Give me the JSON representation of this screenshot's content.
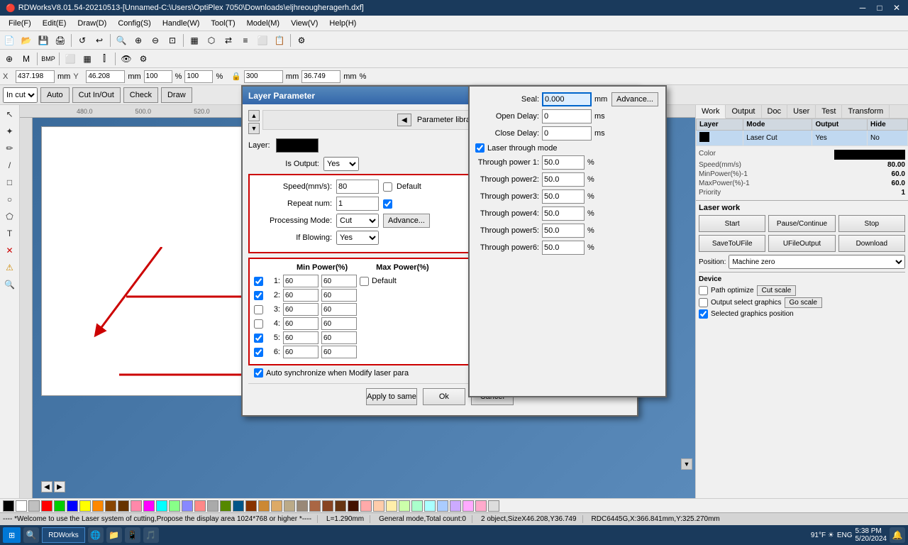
{
  "titlebar": {
    "title": "RDWorksV8.01.54-20210513-[Unnamed-C:\\Users\\OptiPlex 7050\\Downloads\\eljhreougheragerh.dxf]",
    "minimize": "─",
    "maximize": "□",
    "close": "✕"
  },
  "menubar": {
    "items": [
      "File(F)",
      "Edit(E)",
      "Draw(D)",
      "Config(S)",
      "Handle(W)",
      "Tool(T)",
      "Model(M)",
      "View(V)",
      "Help(H)"
    ]
  },
  "coords": {
    "x_label": "X",
    "x_value": "437.198",
    "x_unit": "mm",
    "y_label": "Y",
    "y_value": "46.208",
    "y_unit": "mm",
    "w_pct": "100",
    "h_pct": "100",
    "w_unit": "%",
    "h_unit": "%",
    "w2_value": "300",
    "h2_value": "36.749",
    "mm2": "mm",
    "pct2": "%"
  },
  "mode_bar": {
    "in_cut": "In cut",
    "auto": "Auto",
    "cut_io": "Cut In/Out",
    "check": "Check",
    "draw": "Draw"
  },
  "ruler_marks": [
    "480.0",
    "500.0",
    "520.0"
  ],
  "canvas": {
    "bg_color": "#4a7aaa",
    "white_area": true
  },
  "right_panel": {
    "tabs": [
      "Work",
      "Output",
      "Doc",
      "User",
      "Test",
      "Transform"
    ],
    "active_tab": "Work",
    "table": {
      "headers": [
        "Layer",
        "Mode",
        "Output",
        "Hide"
      ],
      "rows": [
        {
          "layer": "",
          "color": "#000000",
          "mode": "Laser Cut",
          "output": "Yes",
          "hide": "No"
        }
      ]
    },
    "properties": {
      "color_label": "Color",
      "speed_label": "Speed(mm/s)",
      "speed_value": "80.00",
      "min_power_label": "MinPower(%)-1",
      "min_power_value": "60.0",
      "max_power_label": "MaxPower(%)-1",
      "max_power_value": "60.0",
      "priority_label": "Priority",
      "priority_value": "1"
    }
  },
  "laser_work": {
    "title": "Laser work",
    "start": "Start",
    "pause": "Pause/Continue",
    "stop": "Stop",
    "save_to_u": "SaveToUFile",
    "u_output": "UFileOutput",
    "download": "Download",
    "position_label": "Position:",
    "position_value": "Machine zero",
    "path_optimize": "Path optimize",
    "output_select": "Output select graphics",
    "selected_pos": "Selected graphics position",
    "cut_scale": "Cut scale",
    "go_scale": "Go scale",
    "device_label": "Device"
  },
  "dialog": {
    "title": "Layer Parameter",
    "close": "✕",
    "param_lib_label": "Parameter library",
    "layer_label": "Layer:",
    "is_output_label": "Is Output:",
    "is_output_value": "Yes",
    "speed_label": "Speed(mm/s):",
    "speed_value": "80",
    "default_label": "Default",
    "repeat_label": "Repeat num:",
    "repeat_value": "1",
    "proc_mode_label": "Processing Mode:",
    "proc_mode_value": "Cut",
    "advance_label": "Advance...",
    "if_blowing_label": "If Blowing:",
    "if_blowing_value": "Yes",
    "power_header_min": "Min Power(%)",
    "power_header_max": "Max Power(%)",
    "power_rows": [
      {
        "num": "1:",
        "checked": true,
        "min": "60",
        "max": "60",
        "has_default": true
      },
      {
        "num": "2:",
        "checked": true,
        "min": "60",
        "max": "60",
        "has_default": false
      },
      {
        "num": "3:",
        "checked": false,
        "min": "60",
        "max": "60",
        "has_default": false
      },
      {
        "num": "4:",
        "checked": false,
        "min": "60",
        "max": "60",
        "has_default": false
      },
      {
        "num": "5:",
        "checked": true,
        "min": "60",
        "max": "60",
        "has_default": false
      },
      {
        "num": "6:",
        "checked": true,
        "min": "60",
        "max": "60",
        "has_default": false
      }
    ],
    "auto_sync_label": "Auto synchronize when Modify laser para",
    "apply_same": "Apply to same",
    "ok": "Ok",
    "cancel": "Cancel"
  },
  "seal_panel": {
    "seal_label": "Seal:",
    "seal_value": "0.000",
    "seal_unit": "mm",
    "advance_label": "Advance...",
    "open_delay_label": "Open Delay:",
    "open_delay_value": "0",
    "open_delay_unit": "ms",
    "close_delay_label": "Close Delay:",
    "close_delay_value": "0",
    "close_delay_unit": "ms",
    "laser_through": "Laser through mode",
    "through1_label": "Through power 1:",
    "through1_value": "50.0",
    "through1_unit": "%",
    "through2_label": "Through power2:",
    "through2_value": "50.0",
    "through2_unit": "%",
    "through3_label": "Through power3:",
    "through3_value": "50.0",
    "through3_unit": "%",
    "through4_label": "Through power4:",
    "through4_value": "50.0",
    "through4_unit": "%",
    "through5_label": "Through power5:",
    "through5_value": "50.0",
    "through5_unit": "%",
    "through6_label": "Through power6:",
    "through6_value": "50.0",
    "through6_unit": "%"
  },
  "status": {
    "welcome": "---- *Welcome to use the Laser system of cutting,Propose the display area 1024*768 or higher *----",
    "length": "L=1.290mm",
    "general": "General mode,Total count:0",
    "objects": "2 object,SizeX46.208,Y36.749",
    "rdc": "RDC6445G,X:366.841mm,Y:325.270mm"
  },
  "palette": {
    "colors": [
      "#000000",
      "#ffffff",
      "#c0c0c0",
      "#ff0000",
      "#00ff00",
      "#0000ff",
      "#ffff00",
      "#ff8800",
      "#aa4400",
      "#884400",
      "#ff88aa",
      "#ff00ff",
      "#00ffff",
      "#88ff88",
      "#8888ff",
      "#ff8888",
      "#aaaaaa",
      "#558800",
      "#005588",
      "#883300",
      "#cc8833",
      "#ddaa66",
      "#bbaa88",
      "#998877",
      "#aa6644",
      "#884422",
      "#663311",
      "#441100",
      "#ffaaaa",
      "#ffccaa",
      "#ffeeaa",
      "#ccffaa",
      "#aaffcc",
      "#aaffff",
      "#aaccff",
      "#ccaaff",
      "#ffaaff",
      "#ffaacc",
      "#dddddd",
      "#aaaaaa",
      "#777777",
      "#444444",
      "#222222"
    ]
  },
  "taskbar": {
    "start_btn": "⊞",
    "time": "5:38 PM",
    "date": "5/20/2024",
    "weather": "91°F",
    "lang": "ENG"
  }
}
